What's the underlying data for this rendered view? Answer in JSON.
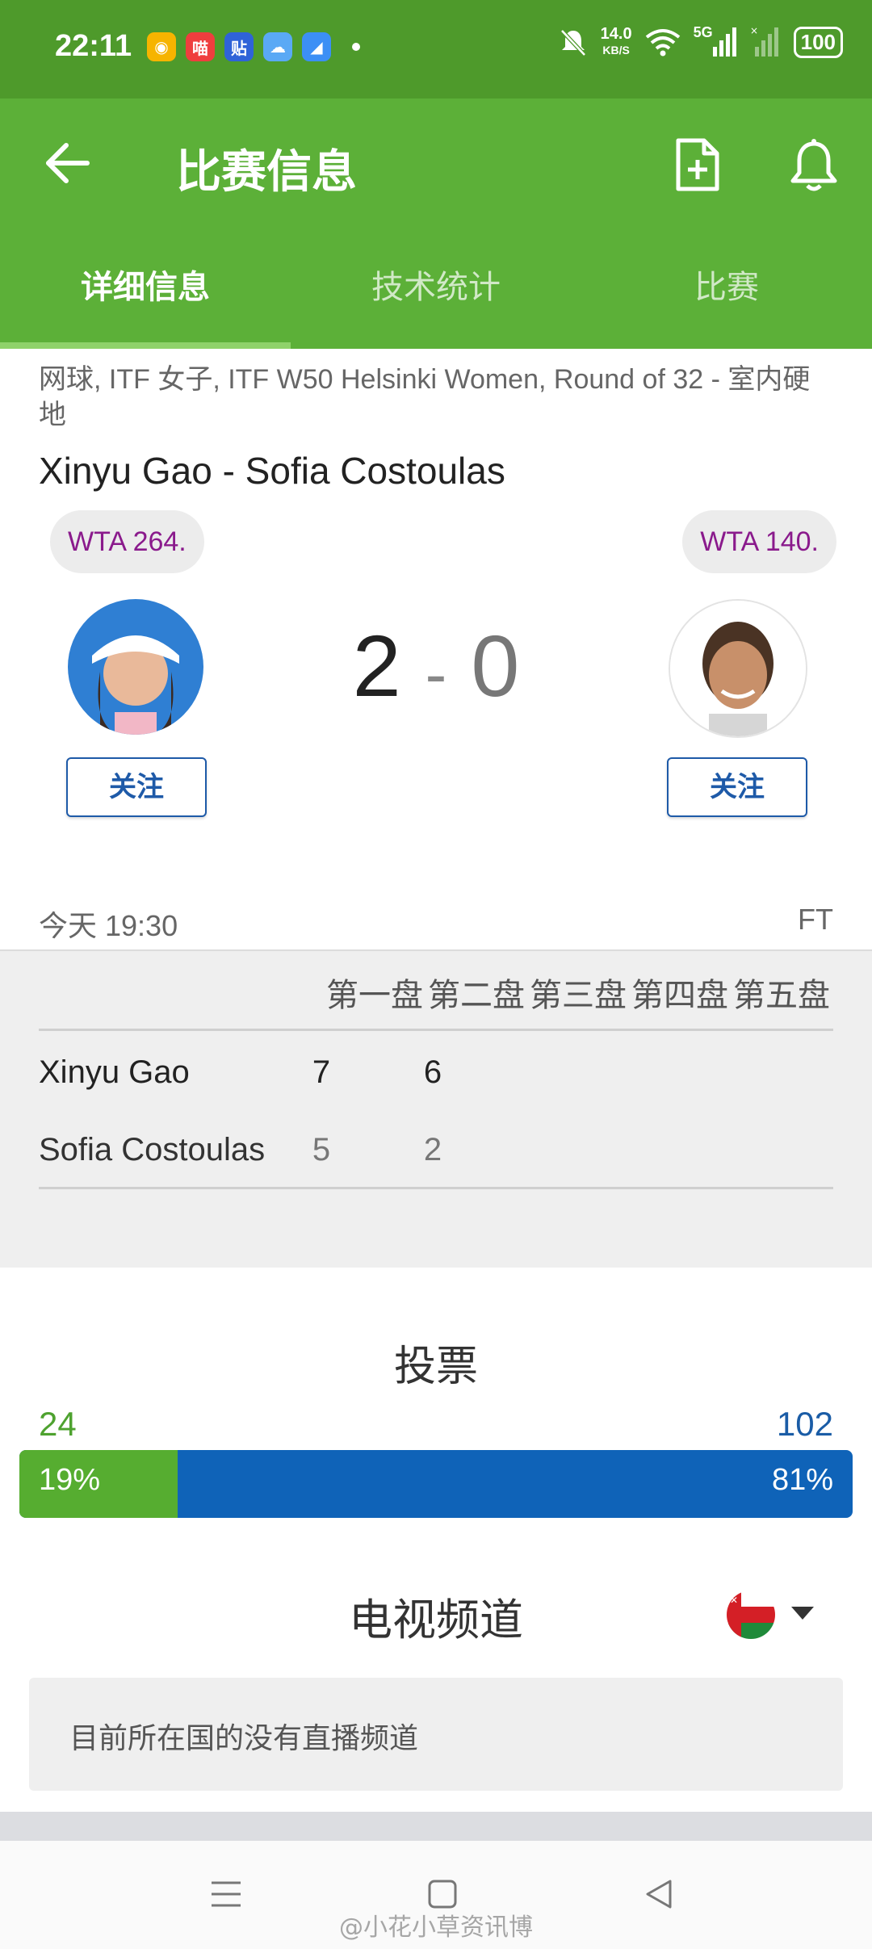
{
  "status_bar": {
    "time": "22:11",
    "net_speed_value": "14.0",
    "net_speed_unit": "KB/S",
    "signal_label": "5G",
    "battery": "100"
  },
  "app_bar": {
    "title": "比赛信息",
    "tabs": [
      {
        "label": "详细信息",
        "active": true
      },
      {
        "label": "技术统计",
        "active": false
      },
      {
        "label": "比赛",
        "active": false
      }
    ]
  },
  "match": {
    "meta": "网球, ITF 女子, ITF W50 Helsinki Women, Round of 32 - 室内硬地",
    "title": "Xinyu Gao - Sofia Costoulas",
    "player1": {
      "rank": "WTA 264.",
      "follow_label": "关注"
    },
    "player2": {
      "rank": "WTA 140.",
      "follow_label": "关注"
    },
    "score_home": "2",
    "score_sep": "-",
    "score_away": "0",
    "date": "今天 19:30",
    "status": "FT"
  },
  "sets": {
    "headers": [
      "第一盘",
      "第二盘",
      "第三盘",
      "第四盘",
      "第五盘"
    ],
    "rows": [
      {
        "name": "Xinyu Gao",
        "s1": "7",
        "s2": "6"
      },
      {
        "name": "Sofia Costoulas",
        "s1": "5",
        "s2": "2"
      }
    ]
  },
  "vote": {
    "title": "投票",
    "home_count": "24",
    "away_count": "102",
    "home_pct": "19%",
    "away_pct": "81%",
    "home_fraction": 0.19
  },
  "tv": {
    "title": "电视频道",
    "empty_text": "目前所在国的没有直播频道"
  },
  "watermark": "@小花小草资讯博",
  "colors": {
    "status_green": "#4e9a2b",
    "bar_green": "#5cb038",
    "vote_green": "#56ad30",
    "vote_blue": "#0f63b8",
    "rank_purple": "#8a1a8c",
    "follow_blue": "#1e5aa8"
  },
  "icons": [
    "back-arrow-icon",
    "add-document-icon",
    "bell-icon",
    "menu-lines-icon",
    "home-square-icon",
    "back-triangle-icon"
  ]
}
